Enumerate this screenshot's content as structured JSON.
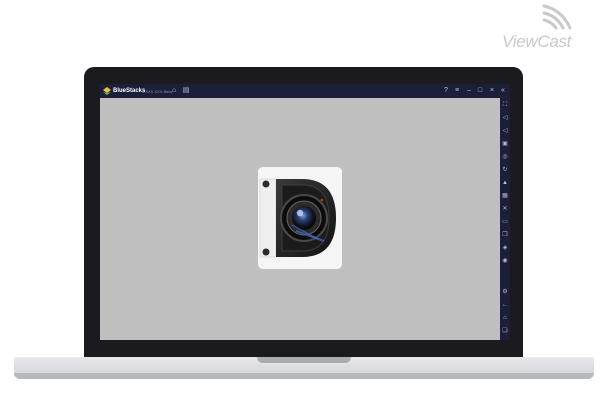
{
  "brand": {
    "name": "ViewCast"
  },
  "emulator": {
    "app_name": "BlueStacks",
    "version": "4.XXX.XXX Beta",
    "title_icons_left": [
      "home-icon",
      "multi-instance-icon"
    ],
    "title_icons_right": [
      "help-icon",
      "menu-icon",
      "minimize-icon",
      "maximize-icon",
      "close-icon",
      "collapse-sidebar-icon"
    ],
    "sidebar_icons": [
      "fullscreen-icon",
      "volume-up-icon",
      "volume-down-icon",
      "video-icon",
      "screenshot-icon",
      "rotate-icon",
      "shake-icon",
      "keyboard-icon",
      "location-icon",
      "folder-icon",
      "copy-icon",
      "layers-icon",
      "macro-icon",
      "settings-icon",
      "back-icon",
      "home-icon",
      "recent-apps-icon"
    ]
  },
  "app": {
    "icon_name": "camera-app-icon"
  },
  "colors": {
    "accent": "#1c1f3a",
    "screen_bg": "#bfbfbf",
    "bezel": "#1b1b1f"
  }
}
